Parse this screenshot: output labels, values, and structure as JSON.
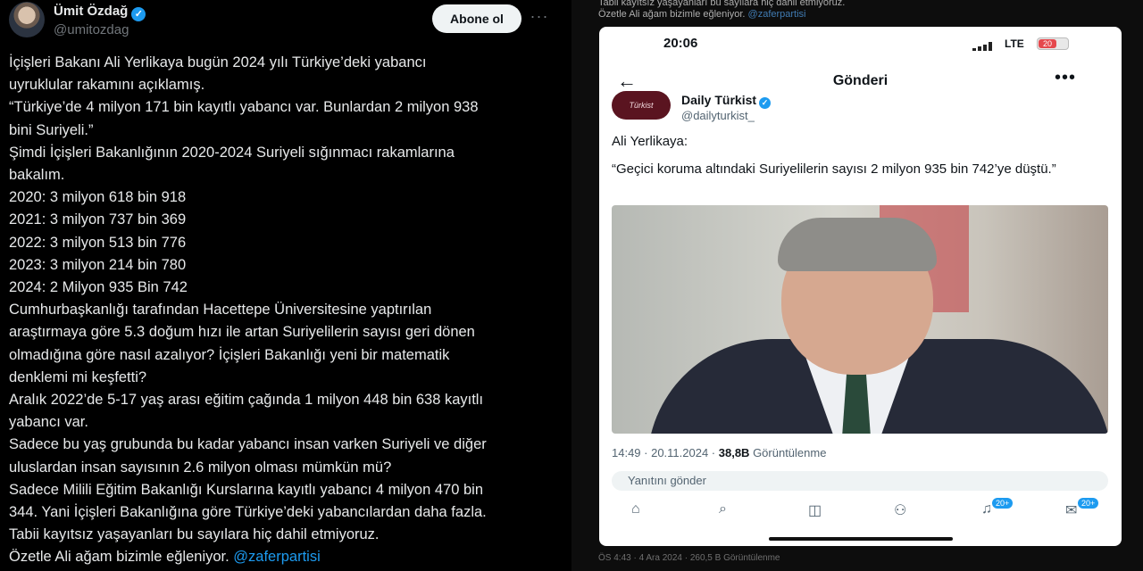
{
  "tweet": {
    "author_name": "Ümit Özdağ",
    "author_handle": "@umitozdag",
    "follow_label": "Abone ol",
    "more_label": "···",
    "lines": [
      "İçişleri Bakanı Ali Yerlikaya bugün 2024 yılı Türkiye’deki yabancı",
      "uyruklular rakamını açıklamış.",
      "“Türkiye’de 4 milyon 171 bin kayıtlı yabancı var.   Bunlardan 2 milyon 938",
      "bini Suriyeli.”",
      "Şimdi İçişleri Bakanlığının 2020-2024 Suriyeli sığınmacı rakamlarına",
      "bakalım.",
      "2020: 3 milyon 618 bin 918",
      "2021: 3 milyon 737 bin 369",
      "2022: 3 milyon 513 bin 776",
      "2023: 3 milyon 214 bin 780",
      "2024: 2 Milyon 935 Bin 742",
      "Cumhurbaşkanlığı tarafından Hacettepe Üniversitesine yaptırılan",
      "araştırmaya göre 5.3 doğum hızı ile artan Suriyelilerin sayısı geri dönen",
      "olmadığına göre nasıl azalıyor? İçişleri Bakanlığı yeni bir matematik",
      "denklemi mi keşfetti?",
      "Aralık 2022’de 5-17 yaş arası eğitim çağında 1 milyon 448 bin 638 kayıtlı",
      "yabancı var.",
      "Sadece bu yaş grubunda bu kadar yabancı insan varken Suriyeli ve diğer",
      "uluslardan insan sayısının 2.6 milyon olması mümkün mü?",
      "Sadece Milili Eğitim Bakanlığı Kurslarına kayıtlı yabancı 4 milyon 470 bin",
      "344. Yani İçişleri Bakanlığına göre Türkiye’deki yabancılardan daha fazla.",
      "Tabii kayıtsız yaşayanları bu sayılara hiç dahil etmiyoruz."
    ],
    "last_line_text": "Özetle Ali ağam bizimle eğleniyor. ",
    "last_line_link": "@zaferpartisi"
  },
  "embed": {
    "echo_line1": "Tabii kayıtsız yaşayanları bu sayılara hiç dahil etmiyoruz.",
    "echo_line2_text": "Özetle Ali ağam bizimle eğleniyor. ",
    "echo_line2_link": "@zaferpartisi",
    "status_time": "20:06",
    "network": "LTE",
    "battery": "20",
    "nav_title": "Gönderi",
    "source_name": "Daily Türkist",
    "source_handle": "@dailyturkist_",
    "source_logo_text": "Türkist",
    "lead": "Ali Yerlikaya:",
    "quote": "“Geçici koruma altındaki Suriyelilerin sayısı 2 milyon 935 bin 742’ye düştü.”",
    "meta_time": "14:49 · 20.11.2024 · ",
    "meta_views": "38,8B",
    "meta_views_label": " Görüntülenme",
    "reply_placeholder": "Yanıtını gönder",
    "badge_notifications": "20+",
    "badge_messages": "20+",
    "bottom_echo": "ÖS 4:43 · 4 Ara 2024 · 260,5 B Görüntülenme"
  },
  "icons": [
    "verified-icon",
    "home-icon",
    "search-icon",
    "grok-icon",
    "communities-icon",
    "bell-icon",
    "mail-icon",
    "back-arrow-icon"
  ]
}
